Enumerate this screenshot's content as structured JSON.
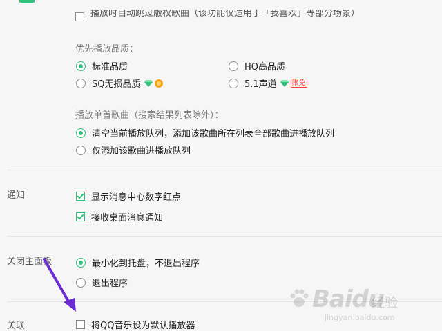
{
  "truncated_top_option": "播放时自动跳过版权歌曲（该功能仅适用于「我喜欢」等部分场景）",
  "quality": {
    "label": "优先播放品质：",
    "options": [
      {
        "label": "标准品质",
        "selected": true
      },
      {
        "label": "HQ高品质",
        "selected": false
      },
      {
        "label": "SQ无损品质",
        "selected": false,
        "icons": [
          "green-diamond-icon",
          "orange-badge-icon"
        ]
      },
      {
        "label": "5.1声道",
        "selected": false,
        "icons": [
          "green-diamond-icon"
        ],
        "badge": "限免"
      }
    ]
  },
  "single_play": {
    "label": "播放单首歌曲（搜索结果列表除外）：",
    "options": [
      {
        "label": "清空当前播放队列，添加该歌曲所在列表全部歌曲进播放队列",
        "selected": true
      },
      {
        "label": "仅添加该歌曲进播放队列",
        "selected": false
      }
    ]
  },
  "notify": {
    "label": "通知",
    "options": [
      {
        "label": "显示消息中心数字红点",
        "checked": true
      },
      {
        "label": "接收桌面消息通知",
        "checked": true
      }
    ]
  },
  "close_panel": {
    "label": "关闭主面板",
    "options": [
      {
        "label": "最小化到托盘，不退出程序",
        "selected": true
      },
      {
        "label": "退出程序",
        "selected": false
      }
    ]
  },
  "association": {
    "label": "关联",
    "options": [
      {
        "label": "将QQ音乐设为默认播放器",
        "checked": false
      }
    ]
  },
  "watermark": {
    "brand": "Baidu",
    "cn": "经验",
    "sub": "jingyan.baidu.com"
  },
  "colors": {
    "accent": "#31c27c",
    "arrow": "#6a2bd3",
    "badge_red": "#ff3b30"
  }
}
